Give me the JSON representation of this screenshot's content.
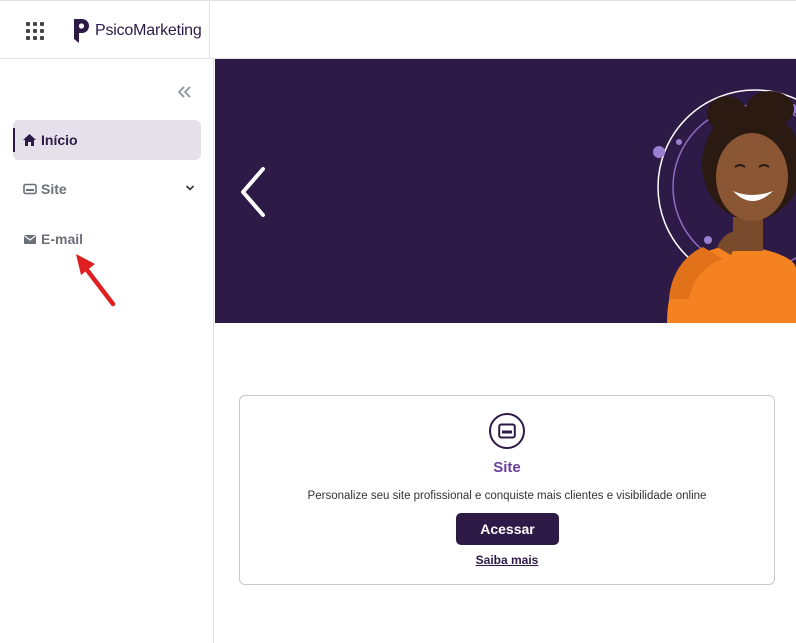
{
  "header": {
    "brand": "PsicoMarketing",
    "apps_icon": "grid-icon",
    "logo_icon": "psicomarketing-logo-icon"
  },
  "sidebar": {
    "collapse_icon": "double-chevron-left-icon",
    "items": [
      {
        "label": "Início",
        "icon": "home-icon",
        "active": true
      },
      {
        "label": "Site",
        "icon": "browser-icon",
        "expandable": true
      },
      {
        "label": "E-mail",
        "icon": "envelope-icon"
      }
    ]
  },
  "hero": {
    "prev_icon": "chevron-left-icon",
    "background_color": "#2d1a47"
  },
  "card": {
    "icon": "browser-icon",
    "title": "Site",
    "description": "Personalize seu site profissional e conquiste mais clientes e visibilidade online",
    "button_label": "Acessar",
    "link_label": "Saiba mais"
  },
  "colors": {
    "brand": "#2d1a47",
    "accent_title": "#6b3fa0",
    "annotation_arrow": "#e02020"
  }
}
